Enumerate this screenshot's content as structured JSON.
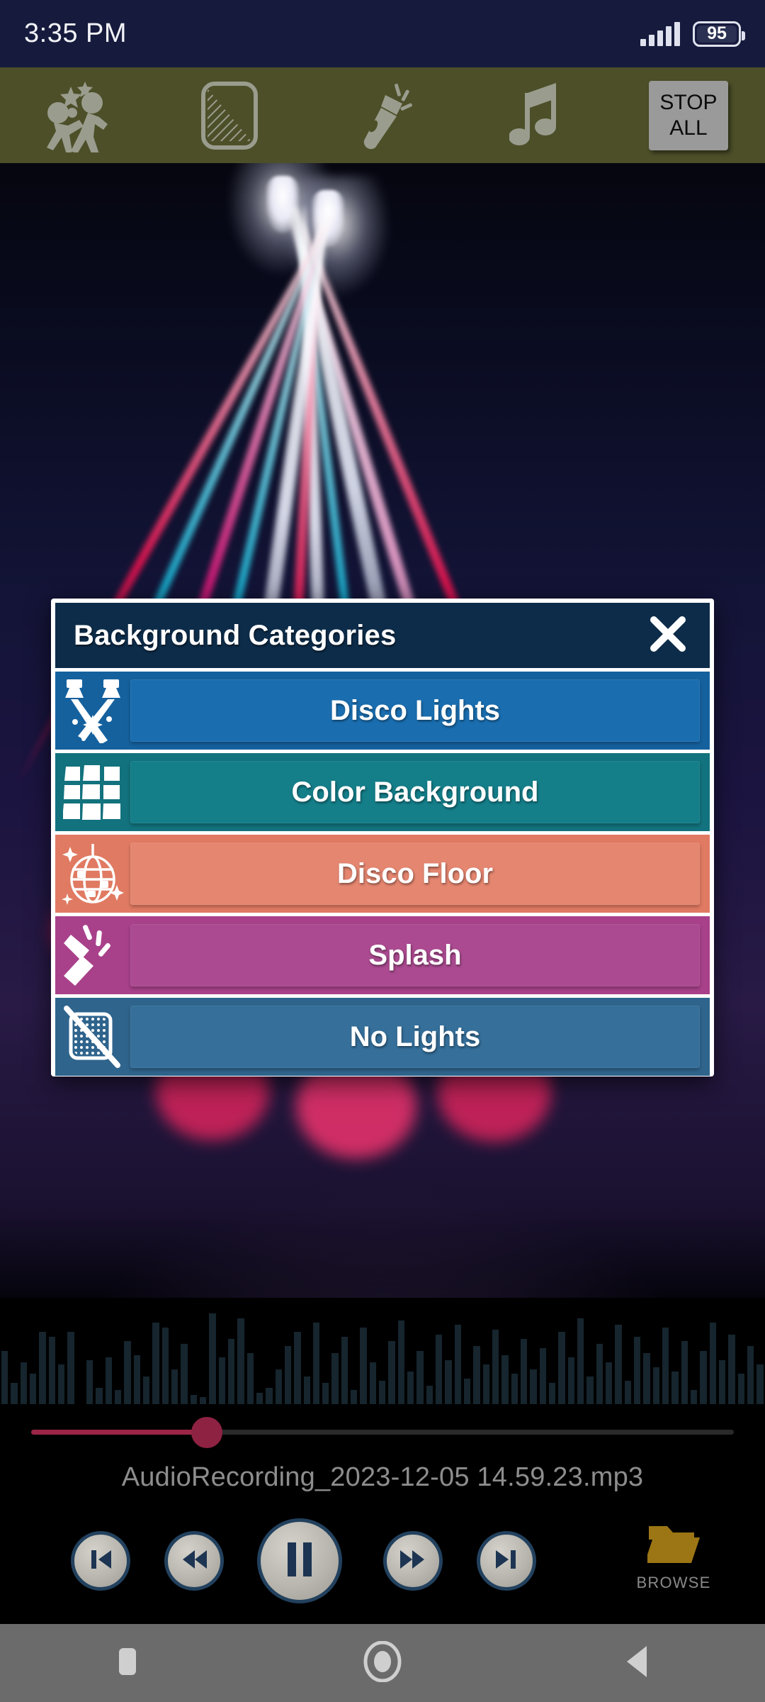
{
  "status_bar": {
    "time": "3:35 PM",
    "battery_percent": "95",
    "signal_icon": "signal-bars-icon",
    "battery_icon": "battery-icon"
  },
  "toolbar": {
    "background_color": "#4c4f28",
    "buttons": [
      {
        "name": "dancers-icon",
        "label": "Dancers"
      },
      {
        "name": "screen-pattern-icon",
        "label": "Screen Pattern"
      },
      {
        "name": "flashlight-icon",
        "label": "Flashlight"
      },
      {
        "name": "music-note-icon",
        "label": "Music"
      }
    ],
    "stop_all": {
      "line1": "STOP",
      "line2": "ALL"
    }
  },
  "dialog": {
    "title": "Background Categories",
    "close_icon": "close-icon",
    "header_color": "#0d2c49",
    "items": [
      {
        "label": "Disco Lights",
        "color": "#15619e",
        "icon": "crossed-spotlights-icon"
      },
      {
        "label": "Color Background",
        "color": "#12727d",
        "icon": "color-grid-icon"
      },
      {
        "label": "Disco Floor",
        "color": "#e07a62",
        "icon": "disco-ball-icon"
      },
      {
        "label": "Splash",
        "color": "#a8418a",
        "icon": "flashlight-beam-icon"
      },
      {
        "label": "No Lights",
        "color": "#2f648c",
        "icon": "no-lights-icon"
      }
    ]
  },
  "player": {
    "track_name": "AudioRecording_2023-12-05 14.59.23.mp3",
    "seek_percent": 25,
    "seek_color": "#9c2546",
    "waveform": [
      46,
      18,
      36,
      26,
      62,
      58,
      34,
      62,
      0,
      38,
      14,
      40,
      12,
      54,
      42,
      24,
      70,
      66,
      30,
      52,
      8,
      6,
      78,
      40,
      56,
      74,
      44,
      10,
      14,
      30,
      50,
      62,
      24,
      70,
      18,
      44,
      58,
      12,
      66,
      36,
      20,
      54,
      72,
      28,
      46,
      16,
      60,
      38,
      68,
      22,
      50,
      34,
      64,
      42,
      26,
      56,
      30,
      48,
      18,
      62,
      40,
      74,
      24,
      52,
      36,
      68,
      20,
      58,
      44,
      32,
      66,
      28,
      54,
      12,
      46,
      70,
      38,
      60,
      26,
      50,
      34
    ],
    "controls": [
      {
        "name": "previous-track-button",
        "icon": "skip-previous-icon",
        "size": "small"
      },
      {
        "name": "rewind-button",
        "icon": "rewind-icon",
        "size": "small"
      },
      {
        "name": "pause-button",
        "icon": "pause-icon",
        "size": "big"
      },
      {
        "name": "fast-forward-button",
        "icon": "fast-forward-icon",
        "size": "small"
      },
      {
        "name": "next-track-button",
        "icon": "skip-next-icon",
        "size": "small"
      }
    ],
    "browse": {
      "label": "BROWSE",
      "icon": "folder-icon",
      "color": "#9c7615"
    }
  },
  "navbar": {
    "items": [
      {
        "name": "recents-button",
        "icon": "square-icon"
      },
      {
        "name": "home-button",
        "icon": "circle-icon"
      },
      {
        "name": "back-button",
        "icon": "triangle-back-icon"
      }
    ]
  }
}
